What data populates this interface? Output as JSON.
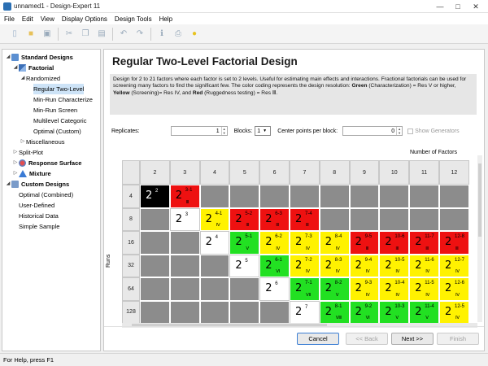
{
  "window": {
    "title": "unnamed1 - Design-Expert 11"
  },
  "menu": [
    "File",
    "Edit",
    "View",
    "Display Options",
    "Design Tools",
    "Help"
  ],
  "toolbar_icons": [
    "new-document-icon",
    "open-folder-icon",
    "save-icon",
    "cut-icon",
    "copy-icon",
    "paste-icon",
    "undo-icon",
    "redo-icon",
    "info-icon",
    "print-icon",
    "tip-bulb-icon"
  ],
  "tree": [
    {
      "label": "Standard Designs",
      "level": 0,
      "bold": true,
      "arrow": "◢",
      "icon": "ico-standard"
    },
    {
      "label": "Factorial",
      "level": 1,
      "bold": true,
      "arrow": "◢",
      "icon": "ico-factorial"
    },
    {
      "label": "Randomized",
      "level": 2,
      "bold": false,
      "arrow": "◢",
      "icon": ""
    },
    {
      "label": "Regular Two-Level",
      "level": 3,
      "bold": false,
      "arrow": "",
      "icon": "",
      "selected": true
    },
    {
      "label": "Min-Run Characterize",
      "level": 3,
      "bold": false,
      "arrow": "",
      "icon": ""
    },
    {
      "label": "Min-Run Screen",
      "level": 3,
      "bold": false,
      "arrow": "",
      "icon": ""
    },
    {
      "label": "Multilevel Categoric",
      "level": 3,
      "bold": false,
      "arrow": "",
      "icon": ""
    },
    {
      "label": "Optimal (Custom)",
      "level": 3,
      "bold": false,
      "arrow": "",
      "icon": ""
    },
    {
      "label": "Miscellaneous",
      "level": 2,
      "bold": false,
      "arrow": "▷",
      "icon": ""
    },
    {
      "label": "Split-Plot",
      "level": 1,
      "bold": false,
      "arrow": "▷",
      "icon": ""
    },
    {
      "label": "Response Surface",
      "level": 1,
      "bold": true,
      "arrow": "▷",
      "icon": "ico-response"
    },
    {
      "label": "Mixture",
      "level": 1,
      "bold": true,
      "arrow": "▷",
      "icon": "ico-mixture"
    },
    {
      "label": "Custom Designs",
      "level": 0,
      "bold": true,
      "arrow": "◢",
      "icon": "ico-custom"
    },
    {
      "label": "Optimal (Combined)",
      "level": 1,
      "bold": false,
      "arrow": "",
      "icon": ""
    },
    {
      "label": "User-Defined",
      "level": 1,
      "bold": false,
      "arrow": "",
      "icon": ""
    },
    {
      "label": "Historical Data",
      "level": 1,
      "bold": false,
      "arrow": "",
      "icon": ""
    },
    {
      "label": "Simple Sample",
      "level": 1,
      "bold": false,
      "arrow": "",
      "icon": ""
    }
  ],
  "page": {
    "title": "Regular Two-Level Factorial Design",
    "desc_1": "Design for 2 to 21 factors where each factor is set to 2 levels. Useful for estimating main effects and interactions. Fractional factorials can be used for screening many factors to find the significant few. The color coding represents the design resolution: ",
    "green_label": "Green",
    "desc_2": " (Characterization) = Res V or higher, ",
    "yellow_label": "Yellow",
    "desc_3": " (Screening)= Res IV, and ",
    "red_label": "Red",
    "desc_4": " (Ruggedness testing) = Res Ⅲ."
  },
  "controls": {
    "replicates_label": "Replicates:",
    "replicates_value": "1",
    "blocks_label": "Blocks:",
    "blocks_value": "1",
    "center_label": "Center points per block:",
    "center_value": "0",
    "show_generators_label": "Show Generators"
  },
  "grid": {
    "factors_label": "Number of Factors",
    "runs_label": "Runs",
    "factors": [
      "2",
      "3",
      "4",
      "5",
      "6",
      "7",
      "8",
      "9",
      "10",
      "11",
      "12"
    ],
    "runs": [
      "4",
      "8",
      "16",
      "32",
      "64",
      "128"
    ],
    "rows": [
      [
        {
          "c": "black",
          "b": "2",
          "s": "2",
          "r": ""
        },
        {
          "c": "red",
          "b": "2",
          "s": "3-1",
          "r": "Ⅲ"
        },
        {
          "c": "gray"
        },
        {
          "c": "gray"
        },
        {
          "c": "gray"
        },
        {
          "c": "gray"
        },
        {
          "c": "gray"
        },
        {
          "c": "gray"
        },
        {
          "c": "gray"
        },
        {
          "c": "gray"
        },
        {
          "c": "gray"
        }
      ],
      [
        {
          "c": "gray"
        },
        {
          "c": "white",
          "b": "2",
          "s": "3",
          "r": ""
        },
        {
          "c": "yellow",
          "b": "2",
          "s": "4-1",
          "r": "Ⅳ"
        },
        {
          "c": "red",
          "b": "2",
          "s": "5-2",
          "r": "Ⅲ"
        },
        {
          "c": "red",
          "b": "2",
          "s": "6-3",
          "r": "Ⅲ"
        },
        {
          "c": "red",
          "b": "2",
          "s": "7-4",
          "r": "Ⅲ"
        },
        {
          "c": "gray"
        },
        {
          "c": "gray"
        },
        {
          "c": "gray"
        },
        {
          "c": "gray"
        },
        {
          "c": "gray"
        }
      ],
      [
        {
          "c": "gray"
        },
        {
          "c": "gray"
        },
        {
          "c": "white",
          "b": "2",
          "s": "4",
          "r": ""
        },
        {
          "c": "green",
          "b": "2",
          "s": "5-1",
          "r": "Ⅴ"
        },
        {
          "c": "yellow",
          "b": "2",
          "s": "6-2",
          "r": "Ⅳ"
        },
        {
          "c": "yellow",
          "b": "2",
          "s": "7-3",
          "r": "Ⅳ"
        },
        {
          "c": "yellow",
          "b": "2",
          "s": "8-4",
          "r": "Ⅳ"
        },
        {
          "c": "red",
          "b": "2",
          "s": "9-5",
          "r": "Ⅲ"
        },
        {
          "c": "red",
          "b": "2",
          "s": "10-6",
          "r": "Ⅲ"
        },
        {
          "c": "red",
          "b": "2",
          "s": "11-7",
          "r": "Ⅲ"
        },
        {
          "c": "red",
          "b": "2",
          "s": "12-8",
          "r": "Ⅲ"
        }
      ],
      [
        {
          "c": "gray"
        },
        {
          "c": "gray"
        },
        {
          "c": "gray"
        },
        {
          "c": "white",
          "b": "2",
          "s": "5",
          "r": ""
        },
        {
          "c": "green",
          "b": "2",
          "s": "6-1",
          "r": "Ⅵ"
        },
        {
          "c": "yellow",
          "b": "2",
          "s": "7-2",
          "r": "Ⅳ"
        },
        {
          "c": "yellow",
          "b": "2",
          "s": "8-3",
          "r": "Ⅳ"
        },
        {
          "c": "yellow",
          "b": "2",
          "s": "9-4",
          "r": "Ⅳ"
        },
        {
          "c": "yellow",
          "b": "2",
          "s": "10-5",
          "r": "Ⅳ"
        },
        {
          "c": "yellow",
          "b": "2",
          "s": "11-6",
          "r": "Ⅳ"
        },
        {
          "c": "yellow",
          "b": "2",
          "s": "12-7",
          "r": "Ⅳ"
        }
      ],
      [
        {
          "c": "gray"
        },
        {
          "c": "gray"
        },
        {
          "c": "gray"
        },
        {
          "c": "gray"
        },
        {
          "c": "white",
          "b": "2",
          "s": "6",
          "r": ""
        },
        {
          "c": "green",
          "b": "2",
          "s": "7-1",
          "r": "Ⅶ"
        },
        {
          "c": "green",
          "b": "2",
          "s": "8-2",
          "r": "Ⅴ"
        },
        {
          "c": "yellow",
          "b": "2",
          "s": "9-3",
          "r": "Ⅳ"
        },
        {
          "c": "yellow",
          "b": "2",
          "s": "10-4",
          "r": "Ⅳ"
        },
        {
          "c": "yellow",
          "b": "2",
          "s": "11-5",
          "r": "Ⅳ"
        },
        {
          "c": "yellow",
          "b": "2",
          "s": "12-6",
          "r": "Ⅳ"
        }
      ],
      [
        {
          "c": "gray"
        },
        {
          "c": "gray"
        },
        {
          "c": "gray"
        },
        {
          "c": "gray"
        },
        {
          "c": "gray"
        },
        {
          "c": "white",
          "b": "2",
          "s": "7",
          "r": ""
        },
        {
          "c": "green",
          "b": "2",
          "s": "8-1",
          "r": "Ⅷ"
        },
        {
          "c": "green",
          "b": "2",
          "s": "9-2",
          "r": "Ⅵ"
        },
        {
          "c": "green",
          "b": "2",
          "s": "10-3",
          "r": "Ⅴ"
        },
        {
          "c": "green",
          "b": "2",
          "s": "11-4",
          "r": "Ⅴ"
        },
        {
          "c": "yellow",
          "b": "2",
          "s": "12-5",
          "r": "Ⅳ"
        }
      ]
    ]
  },
  "buttons": {
    "cancel": "Cancel",
    "back": "<< Back",
    "next": "Next >>",
    "finish": "Finish"
  },
  "status": {
    "text": "For Help, press F1"
  }
}
